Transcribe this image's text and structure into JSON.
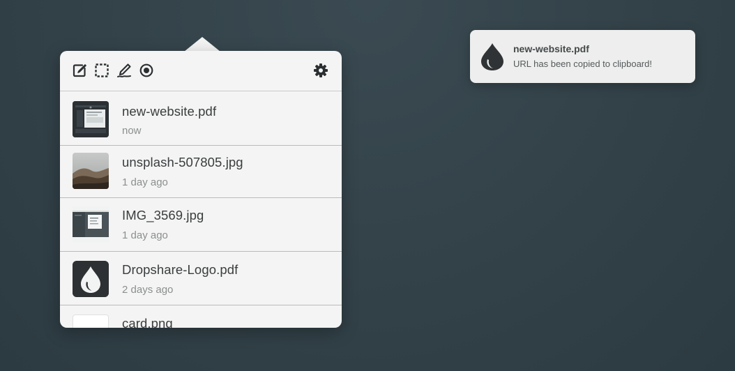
{
  "toolbar": {
    "icons": [
      "edit-note-icon",
      "selection-capture-icon",
      "signature-icon",
      "record-icon",
      "gear-icon"
    ]
  },
  "files": [
    {
      "name": "new-website.pdf",
      "time": "now"
    },
    {
      "name": "unsplash-507805.jpg",
      "time": "1 day ago"
    },
    {
      "name": "IMG_3569.jpg",
      "time": "1 day ago"
    },
    {
      "name": "Dropshare-Logo.pdf",
      "time": "2 days ago"
    },
    {
      "name": "card.png",
      "time": ""
    }
  ],
  "notification": {
    "title": "new-website.pdf",
    "message": "URL has been copied to clipboard!"
  },
  "colors": {
    "background": "#34434a",
    "popover": "#f3f4f3",
    "dark_icon": "#2d3033"
  }
}
